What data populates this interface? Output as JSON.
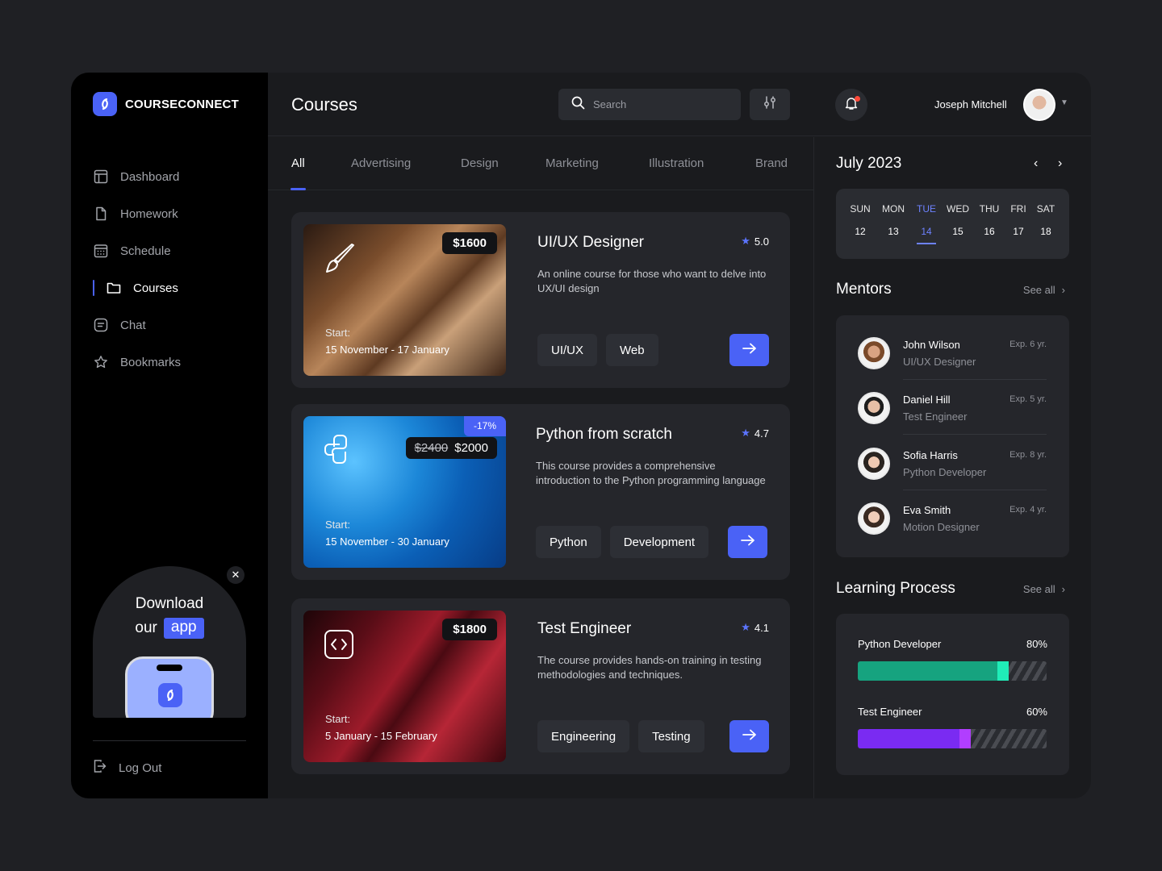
{
  "brand": {
    "name": "COURSECONNECT",
    "accent": "#4a62f6"
  },
  "sidebar": {
    "items": [
      {
        "label": "Dashboard",
        "icon": "dashboard-icon"
      },
      {
        "label": "Homework",
        "icon": "file-icon"
      },
      {
        "label": "Schedule",
        "icon": "calendar-icon"
      },
      {
        "label": "Courses",
        "icon": "folder-icon",
        "active": true
      },
      {
        "label": "Chat",
        "icon": "chat-icon"
      },
      {
        "label": "Bookmarks",
        "icon": "star-icon"
      }
    ],
    "promo": {
      "line1": "Download",
      "line2_prefix": "our",
      "line2_pill": "app"
    },
    "logout": "Log Out"
  },
  "header": {
    "title": "Courses",
    "search_placeholder": "Search",
    "user_name": "Joseph Mitchell"
  },
  "tabs": [
    "All",
    "Advertising",
    "Design",
    "Marketing",
    "Illustration",
    "Brand"
  ],
  "courses": [
    {
      "title": "UI/UX Designer",
      "rating": "5.0",
      "price": "$1600",
      "description": "An online course for those who want to delve into UX/UI design",
      "start_label": "Start:",
      "dates": "15 November - 17 January",
      "tags": [
        "UI/UX",
        "Web"
      ]
    },
    {
      "title": "Python from scratch",
      "rating": "4.7",
      "discount": "-17%",
      "old_price": "$2400",
      "price": "$2000",
      "description": "This course provides a comprehensive introduction to the Python programming language",
      "start_label": "Start:",
      "dates": "15 November - 30 January",
      "tags": [
        "Python",
        "Development"
      ]
    },
    {
      "title": "Test Engineer",
      "rating": "4.1",
      "price": "$1800",
      "description": "The course provides hands-on training in testing methodologies and techniques.",
      "start_label": "Start:",
      "dates": "5 January - 15 February",
      "tags": [
        "Engineering",
        "Testing"
      ]
    }
  ],
  "calendar": {
    "month": "July 2023",
    "days": [
      {
        "dow": "SUN",
        "num": "12"
      },
      {
        "dow": "MON",
        "num": "13"
      },
      {
        "dow": "TUE",
        "num": "14",
        "selected": true
      },
      {
        "dow": "WED",
        "num": "15"
      },
      {
        "dow": "THU",
        "num": "16"
      },
      {
        "dow": "FRI",
        "num": "17"
      },
      {
        "dow": "SAT",
        "num": "18"
      }
    ]
  },
  "mentors": {
    "title": "Mentors",
    "see_all": "See all",
    "items": [
      {
        "name": "John Wilson",
        "role": "UI/UX Designer",
        "exp": "Exp. 6 yr."
      },
      {
        "name": "Daniel Hill",
        "role": "Test Engineer",
        "exp": "Exp. 5 yr."
      },
      {
        "name": "Sofia Harris",
        "role": "Python Developer",
        "exp": "Exp. 8 yr."
      },
      {
        "name": "Eva Smith",
        "role": "Motion Designer",
        "exp": "Exp. 4 yr."
      }
    ]
  },
  "learning": {
    "title": "Learning Process",
    "see_all": "See all",
    "items": [
      {
        "label": "Python Developer",
        "percent": "80%",
        "value": 0.8,
        "color": "#16a37f"
      },
      {
        "label": "Test Engineer",
        "percent": "60%",
        "value": 0.6,
        "color": "#7a2bf2"
      }
    ]
  }
}
